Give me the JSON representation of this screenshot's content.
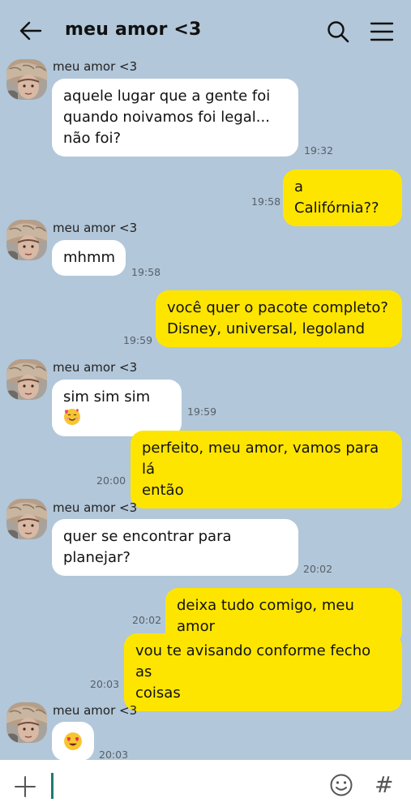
{
  "header": {
    "title": "meu amor <3"
  },
  "messages": [
    {
      "side": "in",
      "sender": "meu amor <3",
      "text_lines": [
        "aquele lugar que a gente foi",
        "quando noivamos foi legal...",
        "não foi?"
      ],
      "time": "19:32"
    },
    {
      "side": "out",
      "text_lines": [
        "a Califórnia??"
      ],
      "time": "19:58"
    },
    {
      "side": "in",
      "sender": "meu amor <3",
      "text_lines": [
        "mhmm"
      ],
      "time": "19:58"
    },
    {
      "side": "out",
      "text_lines": [
        "você quer o pacote completo?",
        "Disney, universal, legoland"
      ],
      "time": "19:59"
    },
    {
      "side": "in",
      "sender": "meu amor <3",
      "text": "sim sim sim",
      "emoji": "smiling-face-with-hearts",
      "time": "19:59"
    },
    {
      "side": "out",
      "text_lines": [
        "perfeito, meu amor, vamos para lá",
        "então"
      ],
      "time": "20:00"
    },
    {
      "side": "in",
      "sender": "meu amor <3",
      "text_lines": [
        "quer se encontrar para",
        "planejar?"
      ],
      "time": "20:02"
    },
    {
      "side": "out",
      "text_lines": [
        "deixa tudo comigo, meu amor"
      ],
      "time": "20:02"
    },
    {
      "side": "out",
      "text_lines": [
        "vou te avisando conforme fecho as",
        "coisas"
      ],
      "time": "20:03"
    },
    {
      "side": "in",
      "sender": "meu amor <3",
      "emoji": "heart-eyes-face",
      "time": "20:03"
    }
  ],
  "colors": {
    "background": "#b2c7d9",
    "incoming_bubble": "#ffffff",
    "outgoing_bubble": "#fee500",
    "caret": "#1c7c73"
  },
  "icons": {
    "back": "back-arrow-icon",
    "search": "search-icon",
    "menu": "menu-icon",
    "plus": "plus-icon",
    "emoji": "emoji-icon",
    "hash": "hash-icon"
  },
  "input": {
    "hash_glyph": "#"
  }
}
